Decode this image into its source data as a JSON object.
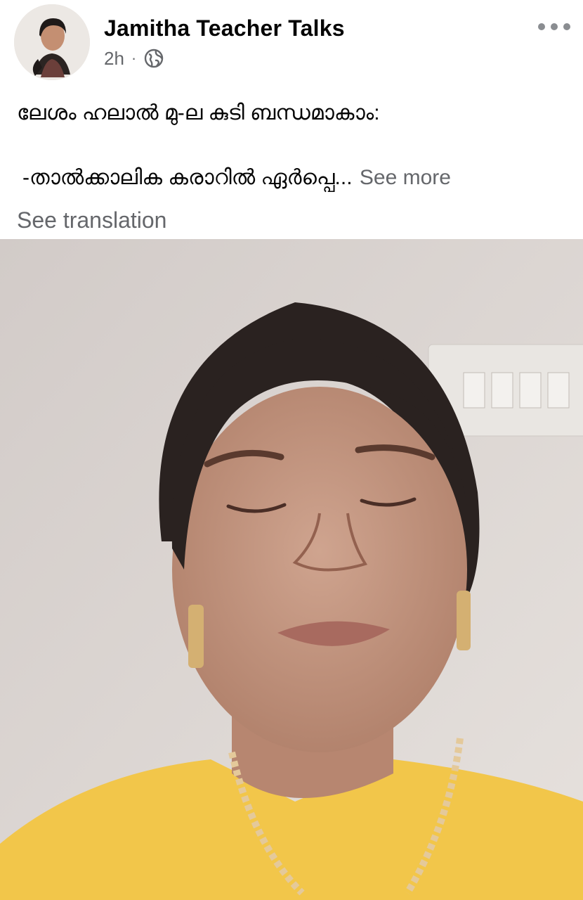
{
  "post": {
    "author_name": "Jamitha Teacher Talks",
    "timestamp": "2h",
    "separator": "·",
    "privacy_icon": "globe-icon",
    "menu_icon": "more-horizontal-icon",
    "text_line_1": "ലേശം ഹലാൽ മു-ല കുടി ബന്ധമാകാം:",
    "text_line_2": "-താൽക്കാലിക കരാറിൽ ഏർപ്പെ...",
    "see_more_label": "See more",
    "see_translation_label": "See translation",
    "photo_description_icon": "post-photo"
  },
  "colors": {
    "text_primary": "#050505",
    "text_secondary": "#65676b",
    "shirt": "#f2c64a",
    "wall": "#d9d3cf"
  }
}
